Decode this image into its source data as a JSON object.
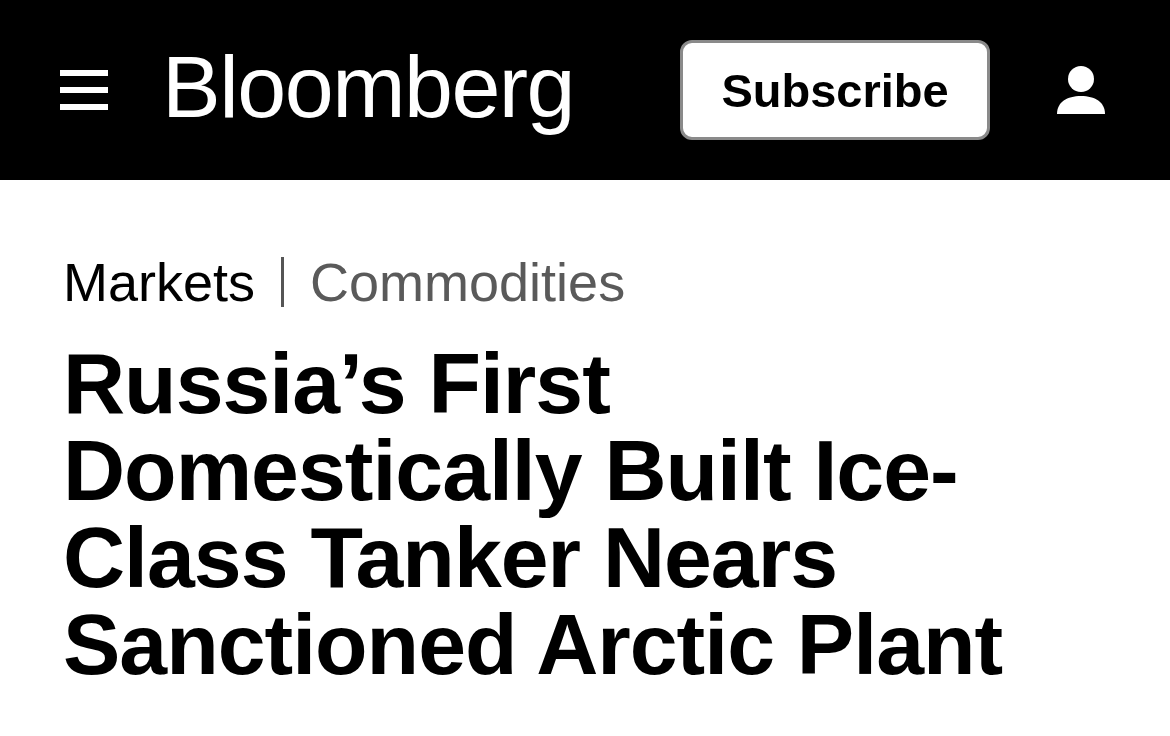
{
  "header": {
    "logo": "Bloomberg",
    "subscribe_button": "Subscribe"
  },
  "breadcrumb": [
    {
      "kind": "section",
      "label": "Markets"
    },
    {
      "kind": "subsection",
      "label": "Commodities"
    }
  ],
  "headline": "Russia’s First Domestically Built Ice-Class Tanker Nears Sanctioned Arctic Plant"
}
